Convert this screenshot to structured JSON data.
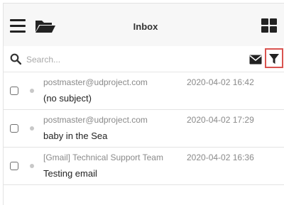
{
  "header": {
    "title": "Inbox",
    "icons": {
      "menu": "hamburger-menu-icon",
      "folder": "open-folder-icon",
      "view": "grid-view-icon"
    }
  },
  "search": {
    "placeholder": "Search...",
    "value": "",
    "icons": {
      "search": "magnifier-icon",
      "mail": "envelope-icon",
      "filter": "filter-funnel-icon"
    },
    "filter_highlight_color": "#d9534f"
  },
  "messages": [
    {
      "sender": "postmaster@udproject.com",
      "date": "2020-04-02 16:42",
      "subject": "(no subject)"
    },
    {
      "sender": "postmaster@udproject.com",
      "date": "2020-04-02 17:29",
      "subject": "baby in the Sea"
    },
    {
      "sender": "[Gmail] Technical Support Team",
      "date": "2020-04-02 16:36",
      "subject": "Testing email"
    }
  ]
}
